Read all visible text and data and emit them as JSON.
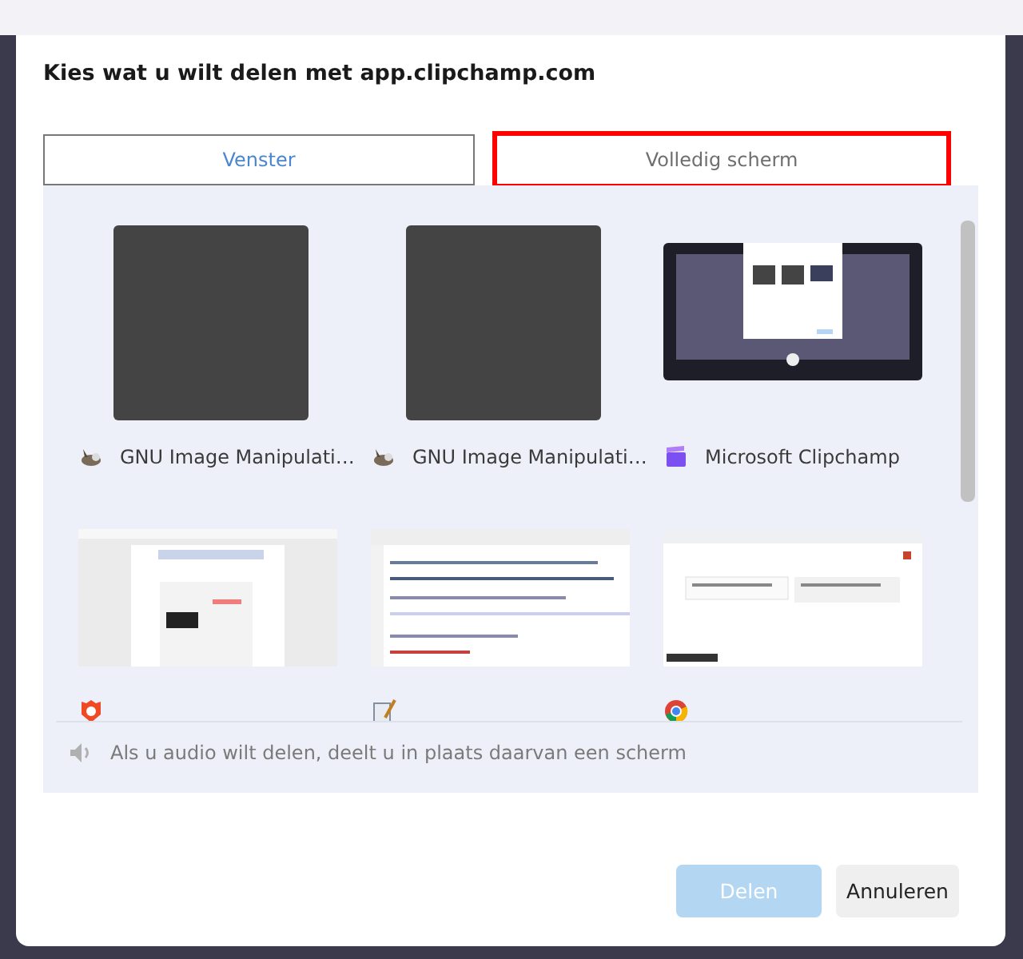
{
  "dialog": {
    "title": "Kies wat u wilt delen met app.clipchamp.com"
  },
  "tabs": [
    {
      "label": "Venster",
      "selected": true,
      "highlighted": false
    },
    {
      "label": "Volledig scherm",
      "selected": false,
      "highlighted": true
    }
  ],
  "windows": [
    {
      "label": "GNU Image Manipulati…",
      "kind": "blank"
    },
    {
      "label": "GNU Image Manipulati…",
      "kind": "blank"
    },
    {
      "label": "Microsoft Clipchamp",
      "kind": "screen"
    },
    {
      "kind": "window"
    },
    {
      "kind": "window"
    },
    {
      "kind": "window"
    }
  ],
  "audio_note": "Als u audio wilt delen, deelt u in plaats daarvan een scherm",
  "buttons": [
    {
      "label": "Delen",
      "disabled": true
    },
    {
      "label": "Annuleren",
      "disabled": false
    }
  ]
}
